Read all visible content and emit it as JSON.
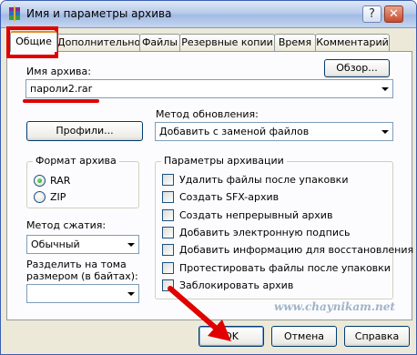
{
  "window": {
    "title": "Имя и параметры архива"
  },
  "tabs": [
    {
      "label": "Общие",
      "active": true
    },
    {
      "label": "Дополнительно",
      "active": false
    },
    {
      "label": "Файлы",
      "active": false
    },
    {
      "label": "Резервные копии",
      "active": false
    },
    {
      "label": "Время",
      "active": false
    },
    {
      "label": "Комментарий",
      "active": false
    }
  ],
  "archive_name": {
    "label": "Имя архива:",
    "value": "пароли2.rar",
    "browse_label": "Обзор..."
  },
  "profiles": {
    "label": "Профили..."
  },
  "update_method": {
    "label": "Метод обновления:",
    "value": "Добавить с заменой файлов"
  },
  "archive_format": {
    "title": "Формат архива",
    "options": [
      {
        "label": "RAR",
        "selected": true
      },
      {
        "label": "ZIP",
        "selected": false
      }
    ]
  },
  "compression": {
    "label": "Метод сжатия:",
    "value": "Обычный"
  },
  "split": {
    "label_line1": "Разделить на тома",
    "label_line2": "размером (в байтах):",
    "value": ""
  },
  "archive_options": {
    "title": "Параметры архивации",
    "items": [
      {
        "label": "Удалить файлы после упаковки",
        "checked": false
      },
      {
        "label": "Создать SFX-архив",
        "checked": false
      },
      {
        "label": "Создать непрерывный архив",
        "checked": false
      },
      {
        "label": "Добавить электронную подпись",
        "checked": false
      },
      {
        "label": "Добавить информацию для восстановления",
        "checked": false
      },
      {
        "label": "Протестировать файлы после упаковки",
        "checked": false
      },
      {
        "label": "Заблокировать архив",
        "checked": false
      }
    ]
  },
  "watermark": "www.chaynikam.net",
  "buttons": {
    "ok": "OK",
    "cancel": "Отмена",
    "help": "Справка"
  },
  "colors": {
    "annotation": "#e00000",
    "tab_highlight": "#e68b2c"
  }
}
